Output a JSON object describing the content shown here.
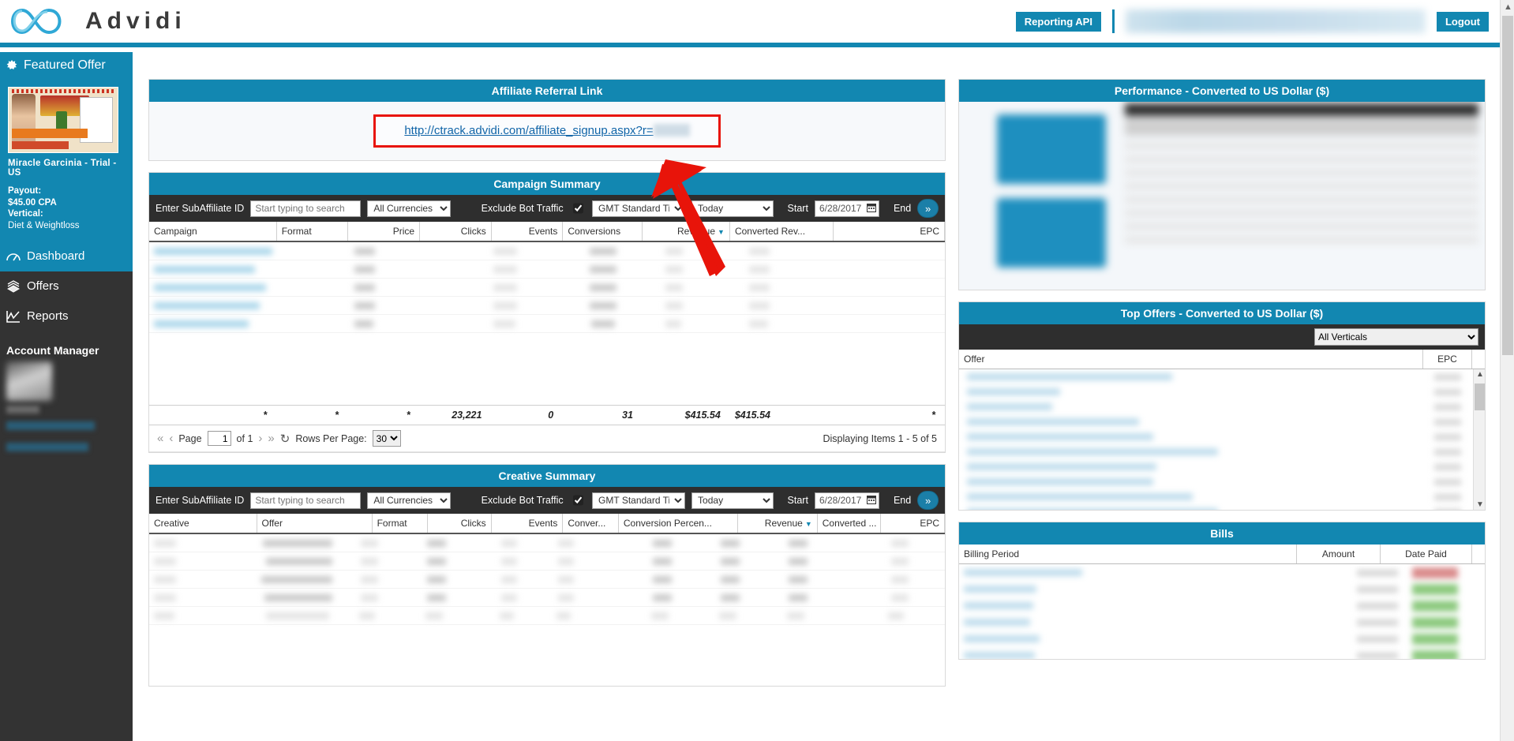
{
  "brand": {
    "name": "Advidi",
    "accent": "#1287b1",
    "dark": "#333333",
    "filter_bar": "#2e2e2e"
  },
  "topbar": {
    "reporting_api_label": "Reporting API",
    "logout_label": "Logout"
  },
  "sidebar": {
    "featured_offer_label": "Featured Offer",
    "offer": {
      "title": "Miracle Garcinia - Trial - US",
      "payout_label": "Payout:",
      "payout_value": "$45.00 CPA",
      "vertical_label": "Vertical:",
      "vertical_value": "Diet & Weightloss"
    },
    "nav": [
      {
        "label": "Dashboard",
        "icon": "dashboard-icon",
        "active": true
      },
      {
        "label": "Offers",
        "icon": "offers-icon",
        "active": false
      },
      {
        "label": "Reports",
        "icon": "reports-icon",
        "active": false
      }
    ],
    "account_manager_label": "Account Manager"
  },
  "referral": {
    "panel_title": "Affiliate Referral Link",
    "url": "http://ctrack.advidi.com/affiliate_signup.aspx?r="
  },
  "campaign_summary": {
    "panel_title": "Campaign Summary",
    "filters": {
      "subaffiliate_label": "Enter SubAffiliate ID",
      "search_placeholder": "Start typing to search",
      "search_value": "",
      "currency_value": "All Currencies",
      "exclude_bot_label": "Exclude Bot Traffic",
      "exclude_bot_checked": true,
      "timezone_value": "GMT Standard Time",
      "range_value": "Today",
      "start_label": "Start",
      "start_value": "6/28/2017",
      "end_label": "End",
      "go_label": "»"
    },
    "columns": [
      "Campaign",
      "Format",
      "Price",
      "Clicks",
      "Events",
      "Conversions",
      "Revenue",
      "Converted Rev...",
      "EPC"
    ],
    "sorted_column": "Revenue",
    "totals": [
      "*",
      "*",
      "*",
      "23,221",
      "0",
      "31",
      "$415.54",
      "$415.54",
      "*"
    ],
    "pager": {
      "page_label": "Page",
      "page_value": "1",
      "of_label": "of 1",
      "rows_per_page_label": "Rows Per Page:",
      "rows_per_page_value": "30",
      "displaying": "Displaying Items 1 - 5 of 5"
    }
  },
  "creative_summary": {
    "panel_title": "Creative Summary",
    "filters": {
      "subaffiliate_label": "Enter SubAffiliate ID",
      "search_placeholder": "Start typing to search",
      "search_value": "",
      "currency_value": "All Currencies",
      "exclude_bot_label": "Exclude Bot Traffic",
      "exclude_bot_checked": true,
      "timezone_value": "GMT Standard Time",
      "range_value": "Today",
      "start_label": "Start",
      "start_value": "6/28/2017",
      "end_label": "End",
      "go_label": "»"
    },
    "columns": [
      "Creative",
      "Offer",
      "Format",
      "Clicks",
      "Events",
      "Conver...",
      "Conversion Percen...",
      "Revenue",
      "Converted ...",
      "EPC"
    ],
    "sorted_column": "Revenue"
  },
  "performance": {
    "panel_title": "Performance - Converted to US Dollar ($)"
  },
  "top_offers": {
    "panel_title": "Top Offers - Converted to US Dollar ($)",
    "verticals_value": "All Verticals",
    "columns": [
      "Offer",
      "EPC"
    ]
  },
  "bills": {
    "panel_title": "Bills",
    "columns": [
      "Billing Period",
      "Amount",
      "Date Paid"
    ]
  }
}
